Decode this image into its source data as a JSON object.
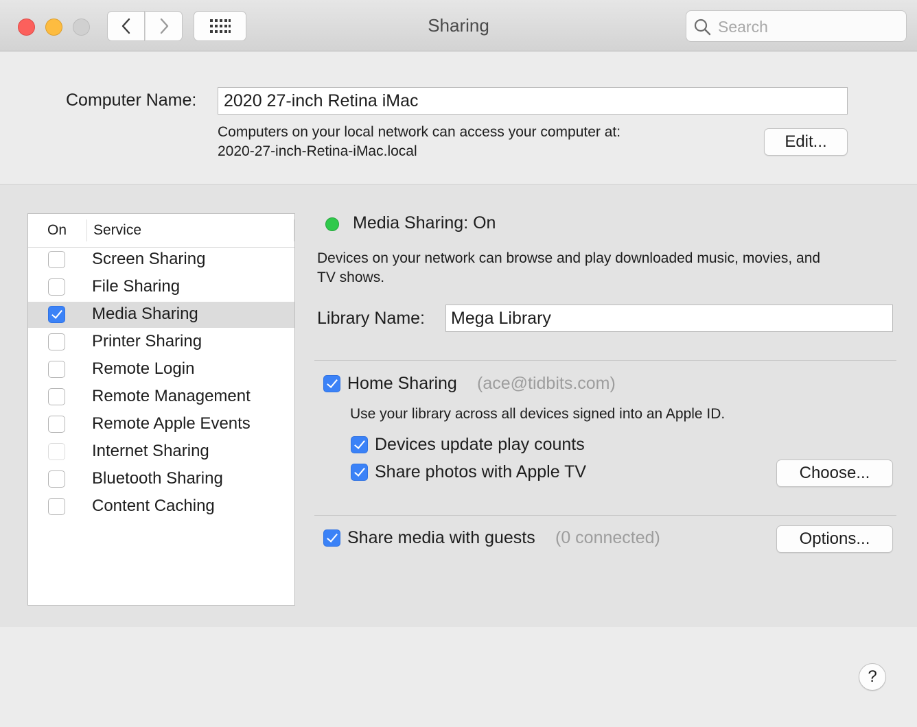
{
  "window": {
    "title": "Sharing"
  },
  "toolbar": {
    "search_placeholder": "Search",
    "back_icon": "chevron-left-icon",
    "forward_icon": "chevron-right-icon",
    "grid_icon": "grid-icon"
  },
  "computer": {
    "name_label": "Computer Name:",
    "name_value": "2020 27-inch Retina iMac",
    "address_line1": "Computers on your local network can access your computer at:",
    "address_line2": "2020-27-inch-Retina-iMac.local",
    "edit_label": "Edit..."
  },
  "services": {
    "header_on": "On",
    "header_service": "Service",
    "items": [
      {
        "label": "Screen Sharing",
        "checked": false
      },
      {
        "label": "File Sharing",
        "checked": false
      },
      {
        "label": "Media Sharing",
        "checked": true,
        "selected": true
      },
      {
        "label": "Printer Sharing",
        "checked": false
      },
      {
        "label": "Remote Login",
        "checked": false
      },
      {
        "label": "Remote Management",
        "checked": false
      },
      {
        "label": "Remote Apple Events",
        "checked": false
      },
      {
        "label": "Internet Sharing",
        "checked": false,
        "disabled": true
      },
      {
        "label": "Bluetooth Sharing",
        "checked": false
      },
      {
        "label": "Content Caching",
        "checked": false
      }
    ]
  },
  "detail": {
    "status": "Media Sharing: On",
    "status_color": "#2fc94b",
    "description_line1": "Devices on your network can browse and play downloaded music, movies, and",
    "description_line2": "TV shows.",
    "library_label": "Library Name:",
    "library_value": "Mega Library",
    "home_sharing_label": "Home Sharing",
    "home_sharing_account": "(ace@tidbits.com)",
    "home_sharing_desc": "Use your library across all devices signed into an Apple ID.",
    "play_counts_label": "Devices update play counts",
    "share_photos_label": "Share photos with Apple TV",
    "choose_label": "Choose...",
    "guests_label": "Share media with guests",
    "guests_count": "(0 connected)",
    "options_label": "Options..."
  },
  "help": {
    "label": "?"
  },
  "colors": {
    "accent": "#3b82f7",
    "close": "#fc605c",
    "minimize": "#fdbc40",
    "zoom_disabled": "#d0d0d0"
  }
}
